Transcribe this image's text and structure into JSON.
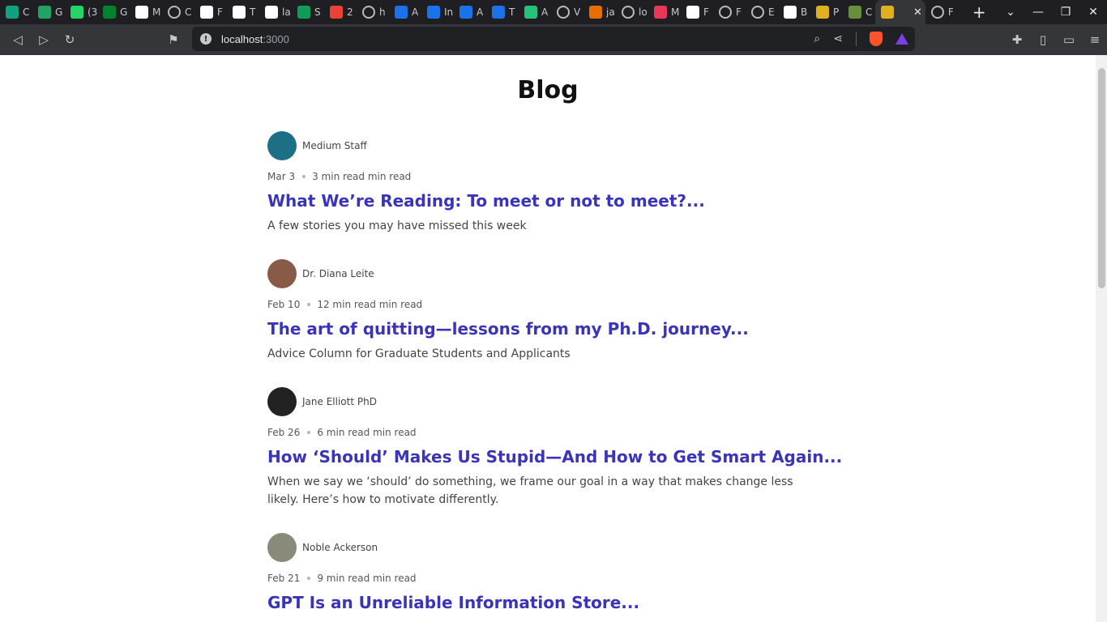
{
  "browser": {
    "tabs": [
      {
        "icon": "chatgpt-icon",
        "color": "#10a37f",
        "label": "C"
      },
      {
        "icon": "google-drive-icon",
        "color": "#1fa463",
        "label": "G"
      },
      {
        "icon": "whatsapp-icon",
        "color": "#25d366",
        "label": "(3"
      },
      {
        "icon": "google-meet-icon",
        "color": "#00832d",
        "label": "G"
      },
      {
        "icon": "google-icon",
        "color": "#ffffff",
        "label": "M"
      },
      {
        "icon": "globe-icon",
        "color": "",
        "label": "C"
      },
      {
        "icon": "notion-icon",
        "color": "#ffffff",
        "label": "F"
      },
      {
        "icon": "openai-icon",
        "color": "#ffffff",
        "label": "T"
      },
      {
        "icon": "lu-icon",
        "color": "#ffffff",
        "label": "la"
      },
      {
        "icon": "sheet-icon",
        "color": "#0f9d58",
        "label": "S"
      },
      {
        "icon": "gmail-icon",
        "color": "#ea4335",
        "label": "2"
      },
      {
        "icon": "globe-icon",
        "color": "",
        "label": "h"
      },
      {
        "icon": "at-icon",
        "color": "#1a73e8",
        "label": "A"
      },
      {
        "icon": "at-icon",
        "color": "#1a73e8",
        "label": "In"
      },
      {
        "icon": "at-icon",
        "color": "#1a73e8",
        "label": "A"
      },
      {
        "icon": "at-icon",
        "color": "#1a73e8",
        "label": "T"
      },
      {
        "icon": "mountain-icon",
        "color": "#27c27a",
        "label": "A"
      },
      {
        "icon": "globe-icon",
        "color": "",
        "label": "V"
      },
      {
        "icon": "java-icon",
        "color": "#e76f00",
        "label": "ja"
      },
      {
        "icon": "globe-icon",
        "color": "",
        "label": "lo"
      },
      {
        "icon": "slash-icon",
        "color": "#e8375a",
        "label": "M"
      },
      {
        "icon": "github-icon",
        "color": "#ffffff",
        "label": "F"
      },
      {
        "icon": "globe-icon",
        "color": "",
        "label": "F"
      },
      {
        "icon": "globe-icon",
        "color": "",
        "label": "E"
      },
      {
        "icon": "github-icon",
        "color": "#ffffff",
        "label": "B"
      },
      {
        "icon": "dots-icon",
        "color": "#e0b020",
        "label": "P"
      },
      {
        "icon": "character-icon",
        "color": "#6a8f3a",
        "label": "C"
      },
      {
        "icon": "dots-icon",
        "color": "#e0b020",
        "label": "",
        "active": true
      },
      {
        "icon": "globe-icon",
        "color": "",
        "label": "F"
      }
    ],
    "url_host": "localhost",
    "url_port": ":3000"
  },
  "page": {
    "title": "Blog",
    "posts": [
      {
        "author": "Medium Staff",
        "date": "Mar 3",
        "read_time": "3 min read min read",
        "title": "What We’re Reading: To meet or not to meet?...",
        "subtitle": "A few stories you may have missed this week",
        "avatar_color": "#1d6f86"
      },
      {
        "author": "Dr. Diana Leite",
        "date": "Feb 10",
        "read_time": "12 min read min read",
        "title": "The art of quitting—lessons from my Ph.D. journey...",
        "subtitle": "Advice Column for Graduate Students and Applicants",
        "avatar_color": "#8a5a48"
      },
      {
        "author": "Jane Elliott PhD",
        "date": "Feb 26",
        "read_time": "6 min read min read",
        "title": "How ‘Should’ Makes Us Stupid—And How to Get Smart Again...",
        "subtitle": "When we say we ‘should’ do something, we frame our goal in a way that makes change less likely. Here’s how to motivate differently.",
        "avatar_color": "#222222"
      },
      {
        "author": "Noble Ackerson",
        "date": "Feb 21",
        "read_time": "9 min read min read",
        "title": "GPT Is an Unreliable Information Store...",
        "subtitle": "",
        "avatar_color": "#8a8a7a"
      }
    ]
  },
  "colors": {
    "link": "#3a35b8",
    "chrome_dark": "#35363a",
    "tabstrip": "#1f1f23"
  }
}
